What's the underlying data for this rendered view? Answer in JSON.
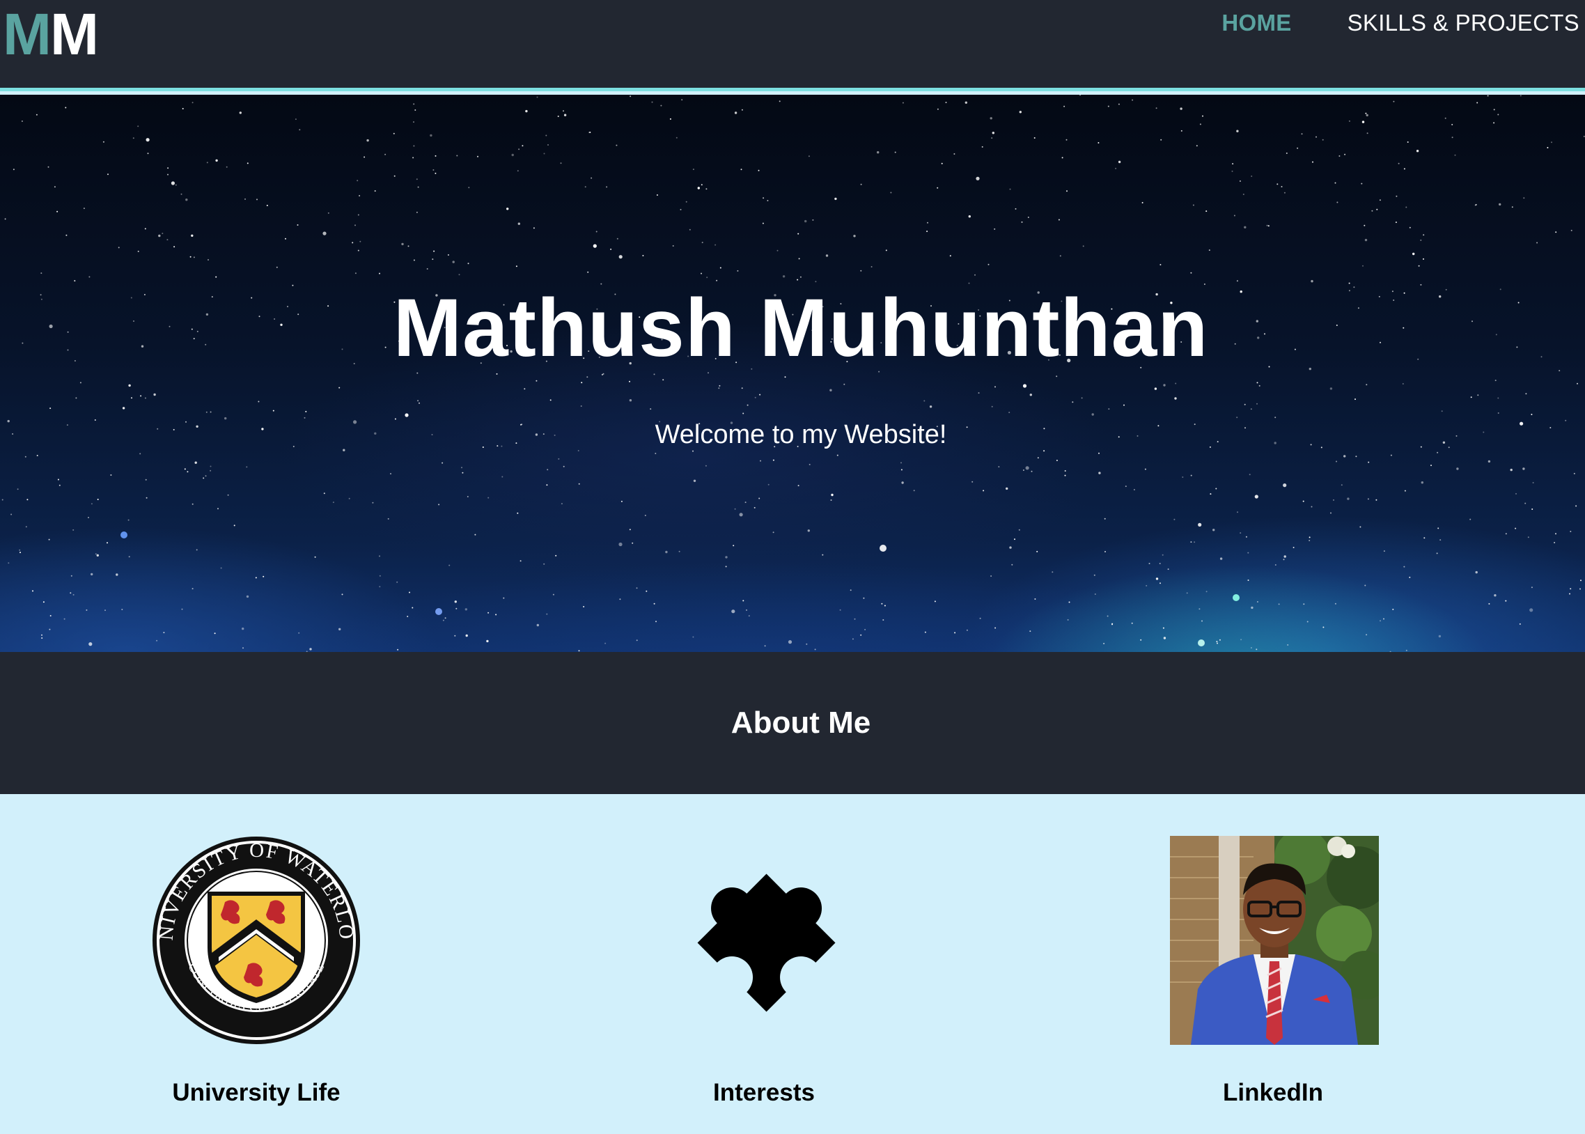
{
  "navbar": {
    "logo": {
      "first": "M",
      "second": "M"
    },
    "links": [
      {
        "label": "HOME",
        "active": true
      },
      {
        "label": "SKILLS & PROJECTS",
        "active": false
      }
    ]
  },
  "hero": {
    "title": "Mathush Muhunthan",
    "subtitle": "Welcome to my Website!"
  },
  "about": {
    "title": "About Me",
    "cards": [
      {
        "label": "University Life",
        "image": "university-of-waterloo-crest",
        "crest_text_top": "UNIVERSITY OF WATERLOO",
        "crest_text_bottom": "CONCORDIA CUM VERITATE"
      },
      {
        "label": "Interests",
        "image": "puzzle-piece-icon"
      },
      {
        "label": "LinkedIn",
        "image": "profile-photo"
      }
    ]
  },
  "colors": {
    "navbar_bg": "#222731",
    "accent": "#5aa3a0",
    "border_accent": "#7ddfe0",
    "cards_bg": "#d2f0fb"
  }
}
